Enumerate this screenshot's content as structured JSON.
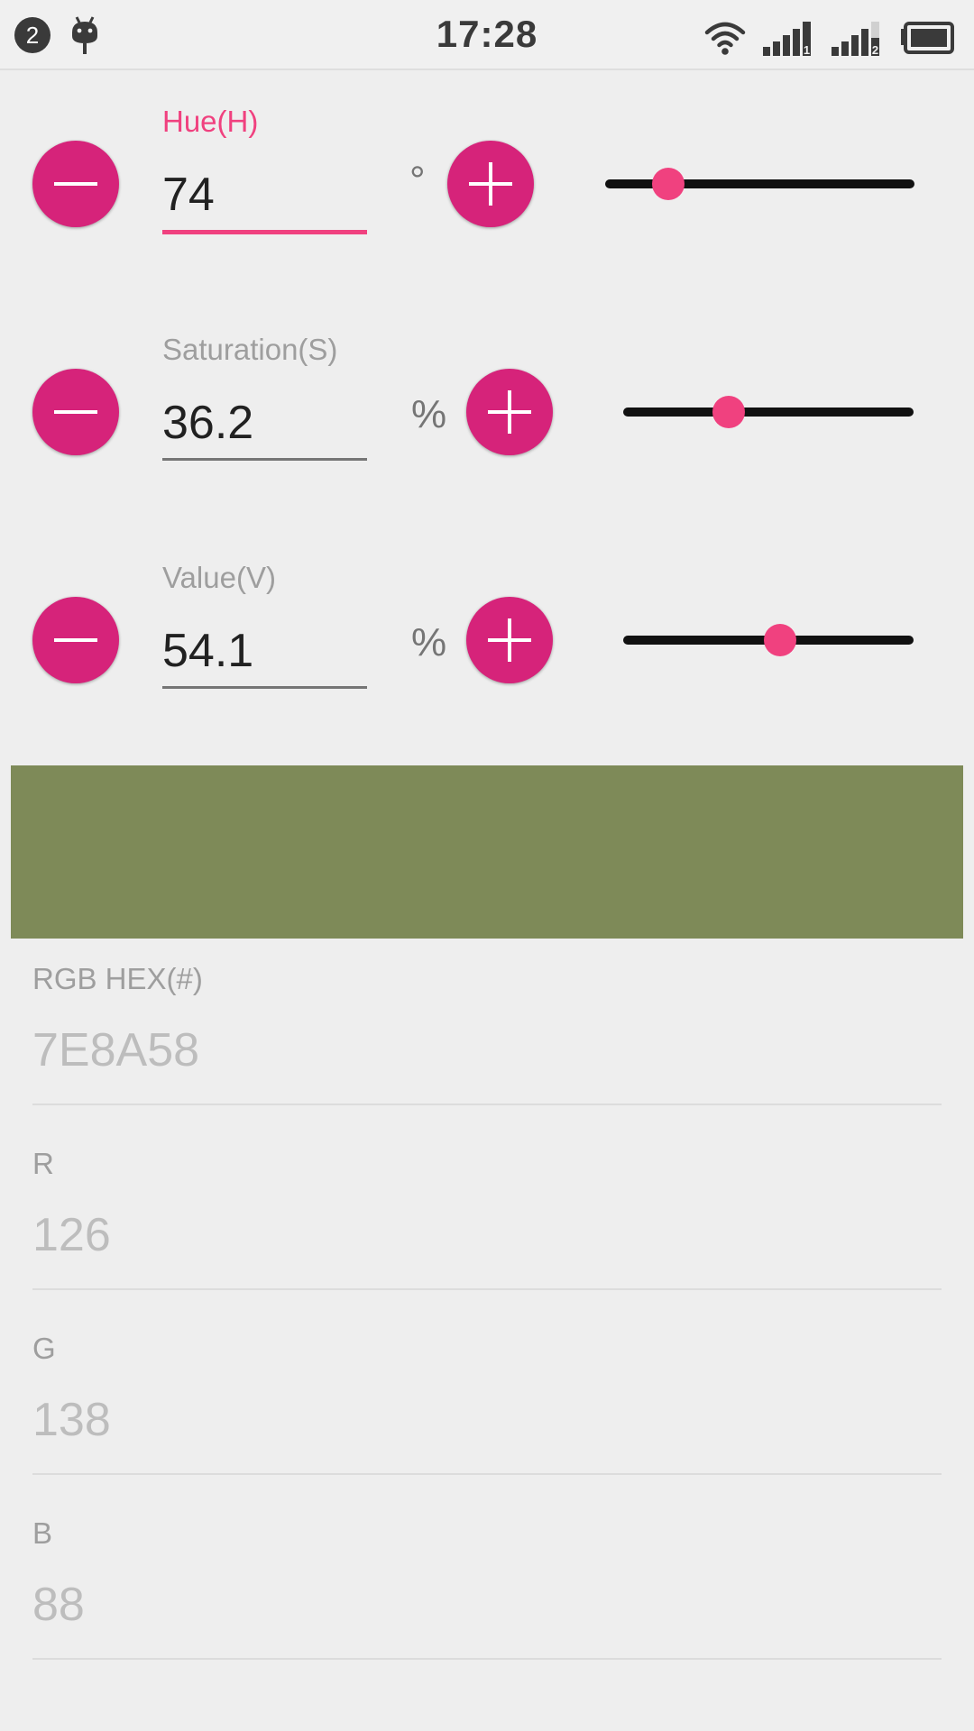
{
  "status_bar": {
    "notification_count": "2",
    "debug_icon": "android-debug-icon",
    "time": "17:28",
    "icons": [
      "wifi-icon",
      "signal-sim1-icon",
      "signal-sim2-icon",
      "battery-icon"
    ],
    "sim1_label": "1",
    "sim2_label": "2"
  },
  "hsv": {
    "hue": {
      "label": "Hue(H)",
      "value": "74",
      "unit": "°",
      "slider_fraction": 0.205
    },
    "saturation": {
      "label": "Saturation(S)",
      "value": "36.2",
      "unit": "%",
      "slider_fraction": 0.362
    },
    "value": {
      "label": "Value(V)",
      "value": "54.1",
      "unit": "%",
      "slider_fraction": 0.541
    },
    "minus_icon": "minus-icon",
    "plus_icon": "plus-icon"
  },
  "preview": {
    "color": "#7E8A58"
  },
  "output": {
    "hex": {
      "label": "RGB HEX(#)",
      "value": "7E8A58"
    },
    "r": {
      "label": "R",
      "value": "126"
    },
    "g": {
      "label": "G",
      "value": "138"
    },
    "b": {
      "label": "B",
      "value": "88"
    }
  },
  "colors": {
    "accent": "#f0417f",
    "button": "#d6237a",
    "background": "#eeeeee"
  }
}
